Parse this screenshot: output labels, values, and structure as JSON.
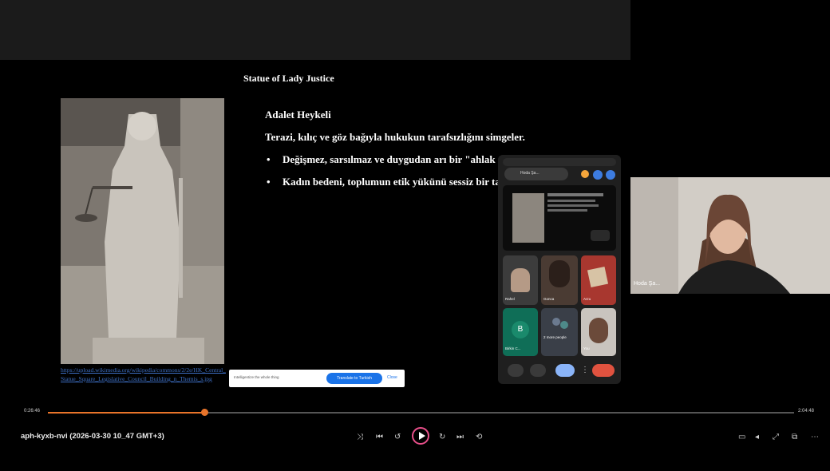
{
  "slide": {
    "title": "Statue of Lady Justice",
    "heading": "Adalet Heykeli",
    "intro": "Terazi, kılıç ve göz bağıyla hukukun tarafsızlığını simgeler.",
    "bullets": [
      "Değişmez, sarsılmaz ve duygudan arı bir \"ahlak anıtı\"dır.",
      "Kadın bedeni, toplumun etik yükünü sessiz bir taşıyıcıdır."
    ],
    "image_source": "https://upload.wikimedia.org/wikipedia/commons/2/2e/HK_Central_Statue_Square_Legislative_Council_Building_n_Themis_s.jpg"
  },
  "translate_bar": {
    "text": "Intelligentize the whole thing",
    "button": "Translate to Turkish",
    "close": "Close"
  },
  "meet": {
    "self_name": "Hoda Şa...",
    "participants": [
      {
        "label": "Rahel"
      },
      {
        "label": "Gonca"
      },
      {
        "label": "Arzu"
      },
      {
        "label": "Birkin C..."
      },
      {
        "label": "2 more people"
      },
      {
        "label": "You"
      }
    ]
  },
  "self_view": {
    "name": "Hoda Şa..."
  },
  "player": {
    "file_title": "aph-kyxb-nvi (2026-03-30 10_47 GMT+3)",
    "time_current": "0:26:46",
    "time_total": "2:04:48",
    "progress_fraction": 0.21,
    "accent": "#e8742a"
  }
}
